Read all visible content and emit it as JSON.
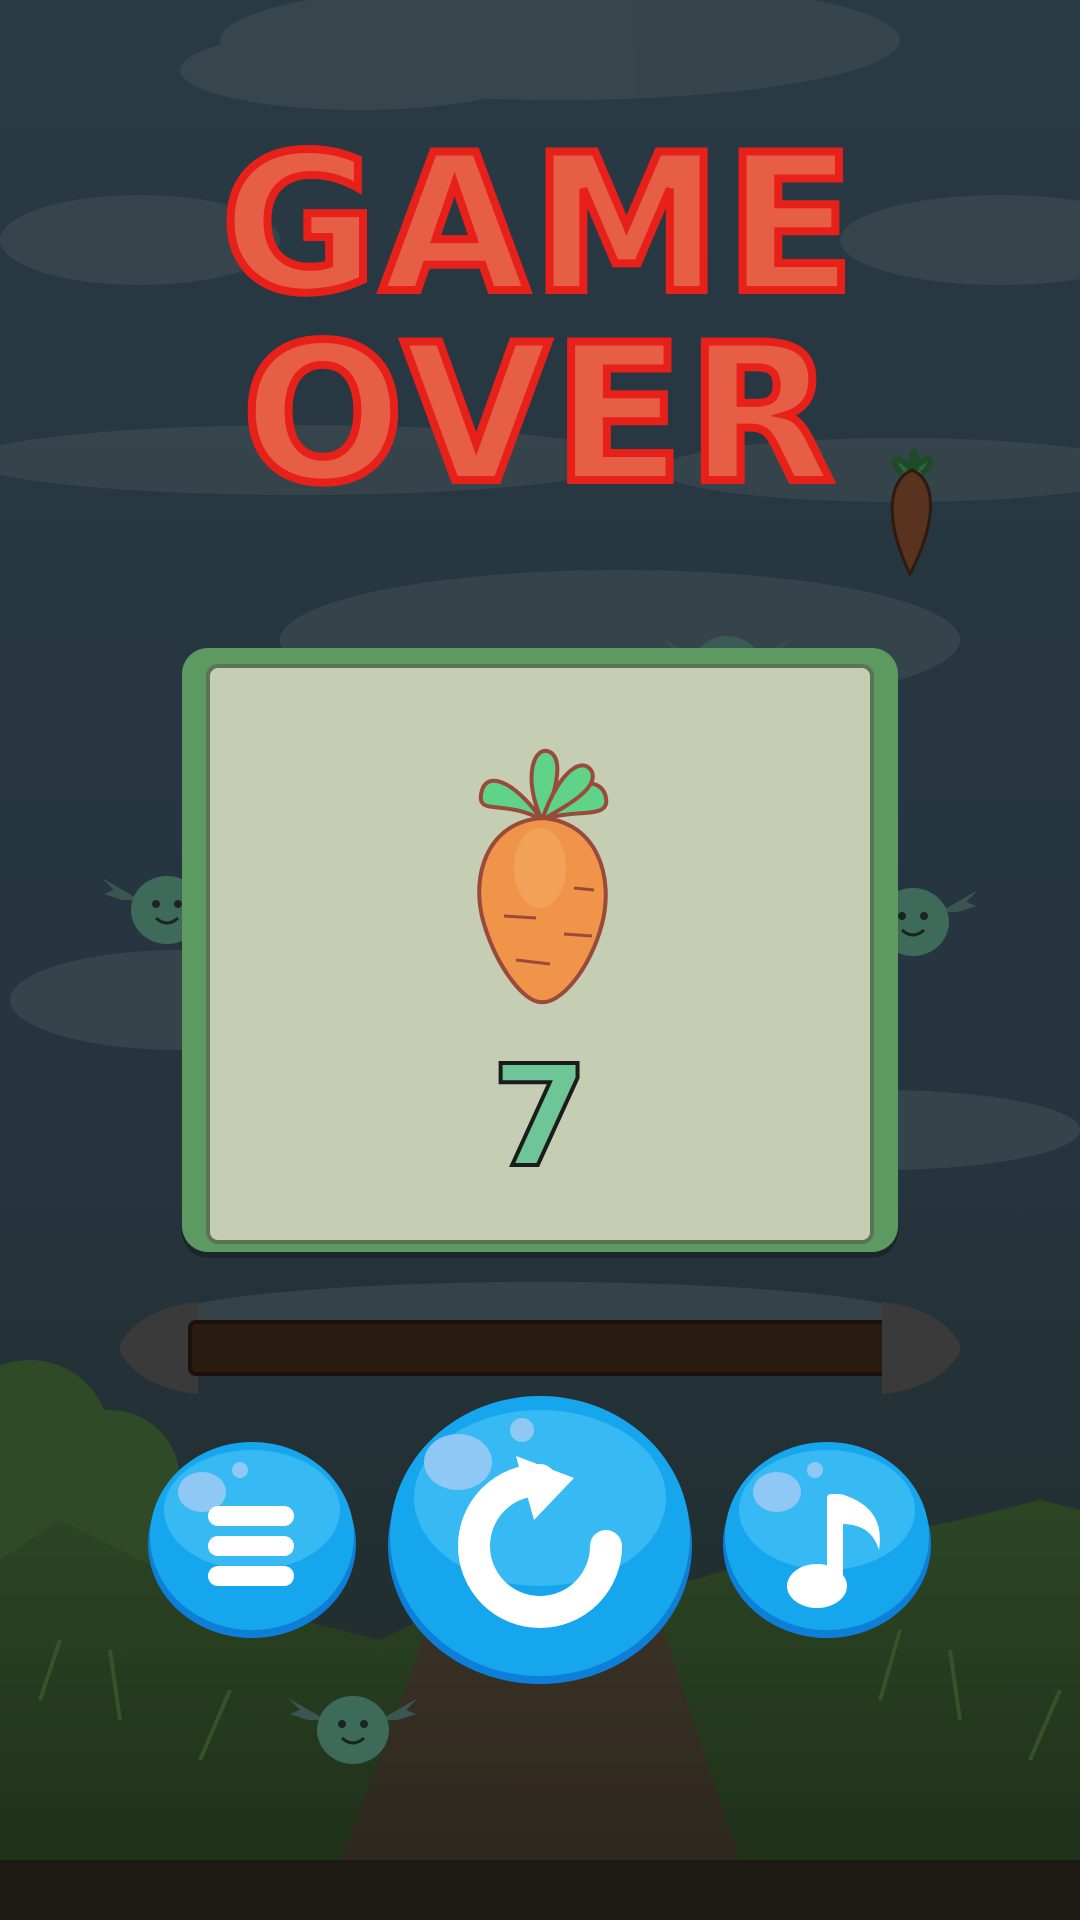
{
  "title": {
    "line1": "GAME",
    "line2": "OVER"
  },
  "result": {
    "score": "7",
    "icon": "carrot-icon"
  },
  "buttons": {
    "menu": {
      "icon": "menu-icon"
    },
    "replay": {
      "icon": "replay-icon"
    },
    "music": {
      "icon": "music-note-icon"
    }
  },
  "colors": {
    "title_fill": "#e55e45",
    "title_stroke": "#e8201a",
    "panel_frame": "#5d9a62",
    "panel_inner": "#cdd2b9",
    "score_fill": "#6ec698",
    "button_blue": "#16a6ee"
  }
}
